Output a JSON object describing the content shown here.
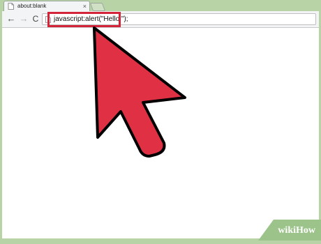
{
  "browser": {
    "tab": {
      "title": "about:blank",
      "close_glyph": "×",
      "icon": "page-icon"
    },
    "toolbar": {
      "back_glyph": "←",
      "forward_glyph": "→",
      "reload_glyph": "C"
    },
    "address_bar": {
      "value": "javascript:alert(\"Hello!\");",
      "icon": "page-icon"
    }
  },
  "overlay": {
    "pointer": "arrow-cursor-icon",
    "pointer_color": "#e03144",
    "highlight_color": "#d3243a"
  },
  "watermark": {
    "brand": "wikiHow"
  }
}
